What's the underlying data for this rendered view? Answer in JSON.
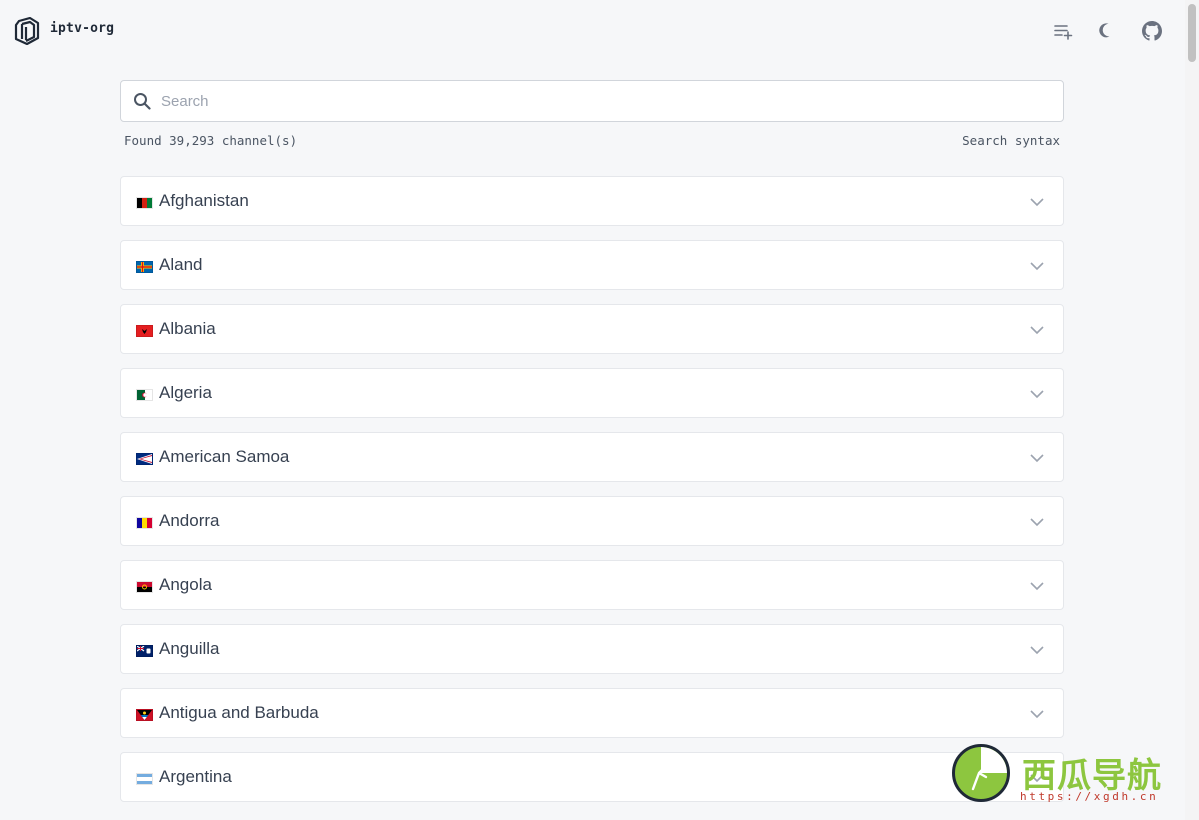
{
  "header": {
    "brand": "iptv-org",
    "icons": [
      "playlist-add-icon",
      "moon-icon",
      "github-icon"
    ]
  },
  "search": {
    "placeholder": "Search",
    "value": ""
  },
  "results": {
    "found_text": "Found 39,293 channel(s)",
    "syntax_link": "Search syntax"
  },
  "countries": [
    {
      "name": "Afghanistan"
    },
    {
      "name": "Aland"
    },
    {
      "name": "Albania"
    },
    {
      "name": "Algeria"
    },
    {
      "name": "American Samoa"
    },
    {
      "name": "Andorra"
    },
    {
      "name": "Angola"
    },
    {
      "name": "Anguilla"
    },
    {
      "name": "Antigua and Barbuda"
    },
    {
      "name": "Argentina"
    }
  ],
  "watermark": {
    "title": "西瓜导航",
    "url": "https://xgdh.cn"
  },
  "colors": {
    "background": "#f6f7f9",
    "card": "#ffffff",
    "border": "#e5e7eb",
    "text": "#374151",
    "watermark_green": "#8dc63f",
    "watermark_red": "#c0392b"
  }
}
